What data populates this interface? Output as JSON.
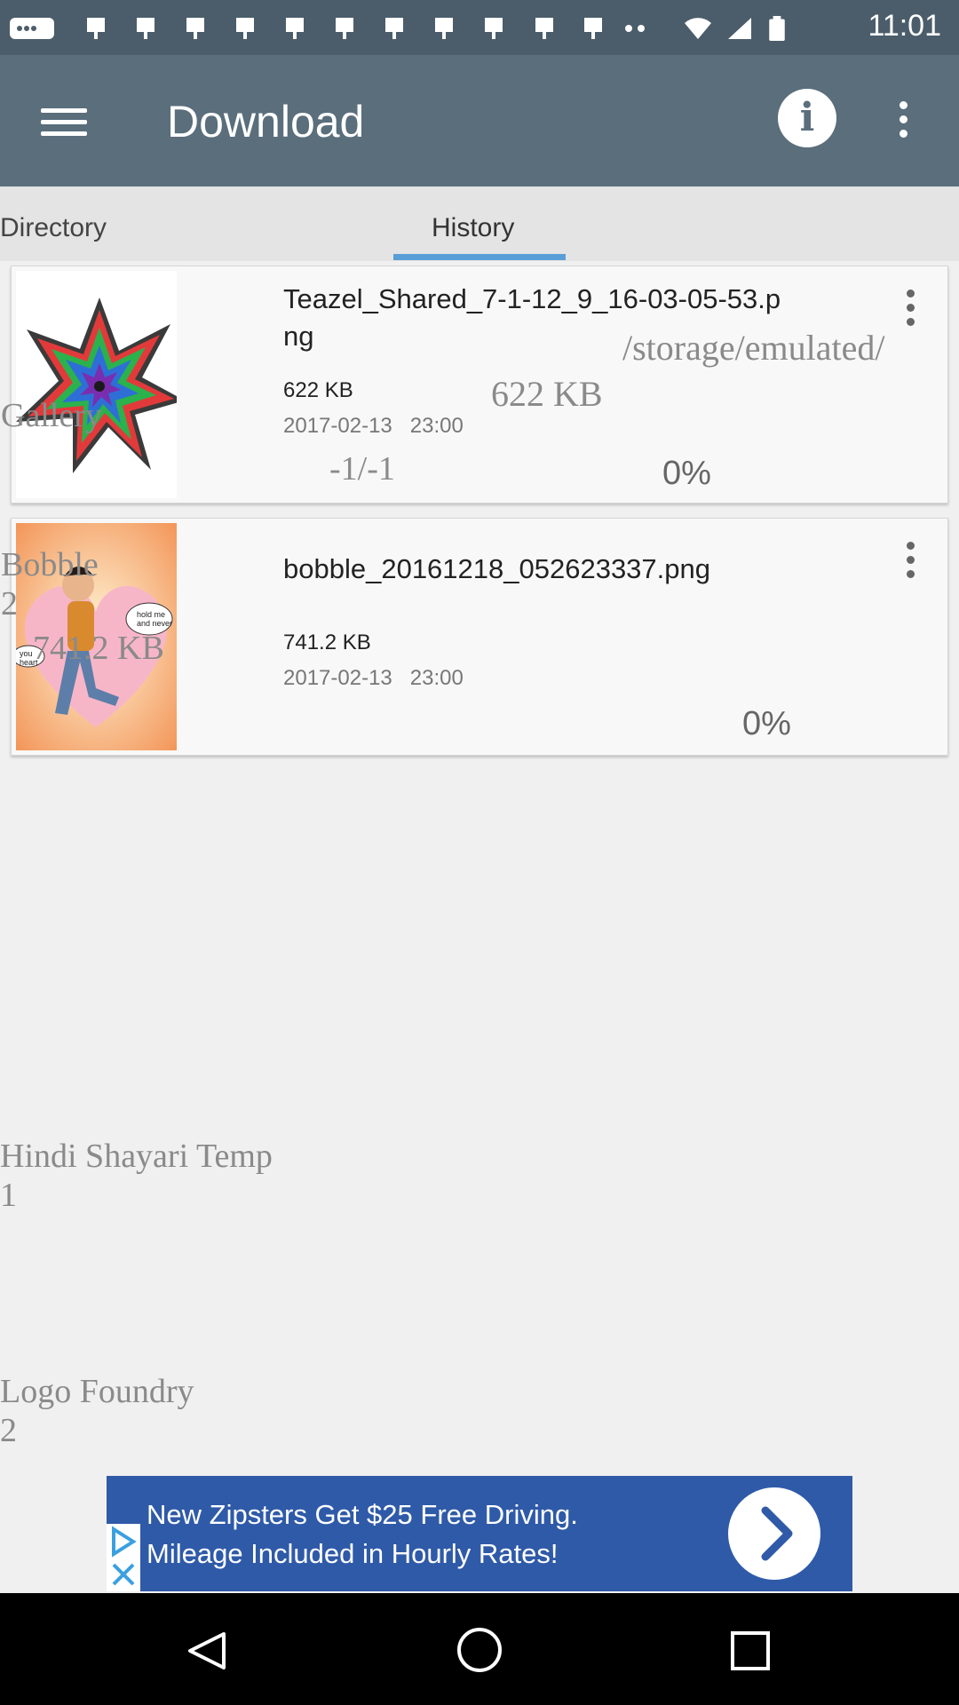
{
  "status_bar": {
    "time": "11:01"
  },
  "app_bar": {
    "title": "Download"
  },
  "tabs": [
    {
      "label": "Directory"
    },
    {
      "label": "History"
    }
  ],
  "downloads": [
    {
      "filename": "Teazel_Shared_7-1-12_9_16-03-05-53.png",
      "filename_line1": "Teazel_Shared_7-1-12_9_16-03-05-53.p",
      "filename_line2": "ng",
      "size": "622 KB",
      "date": "2017-02-13",
      "time": "23:00",
      "progress_text": "0%",
      "extra_size": "622 KB",
      "extra_count": "-1/-1",
      "extra_path": "/storage/emulated/"
    },
    {
      "filename": "bobble_20161218_052623337.png",
      "size": "741.2 KB",
      "date": "2017-02-13",
      "time": "23:00",
      "progress_text": "0%",
      "thumb_text_1": "hold me and never",
      "thumb_text_2": "you heart"
    }
  ],
  "background_directory": [
    {
      "name": "Gallery",
      "count": ""
    },
    {
      "name": "Bobble",
      "count": "2",
      "size": "741.2 KB"
    },
    {
      "name": "Hindi Shayari Temp",
      "count": "1"
    },
    {
      "name": "Logo Foundry",
      "count": "2"
    }
  ],
  "ad": {
    "line1": "New Zipsters Get $25 Free Driving.",
    "line2": "Mileage Included in Hourly Rates!"
  },
  "colors": {
    "app_bar": "#5a6e7c",
    "status_bar": "#4b5d6a",
    "tab_indicator": "#5a9ed8",
    "ad_background": "#2f5aa8"
  }
}
